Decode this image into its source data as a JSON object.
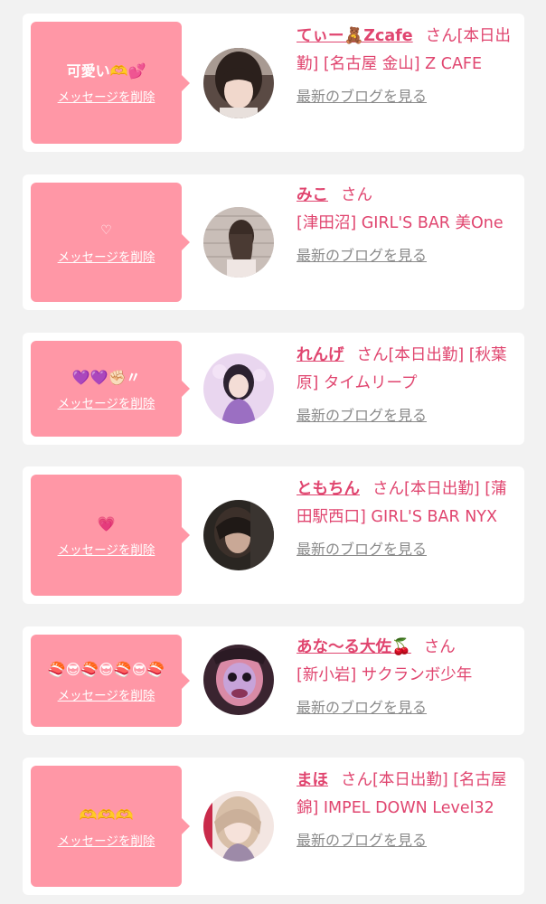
{
  "colors": {
    "background": "#f2f2f2",
    "card": "#ffffff",
    "bubble": "#ff97a6",
    "accent_text": "#e0456f",
    "link_gray": "#8a8a8a"
  },
  "items": [
    {
      "message": "可愛い🫶💕",
      "delete_label": "メッセージを削除",
      "name": "てぃー🧸Zcafe",
      "honorific": "さん",
      "details": "[本日出勤] [名古屋 金山] Z CAFE",
      "blog_label": "最新のブログを見る",
      "avatar_icon": "cast-photo-woman-dark-hair"
    },
    {
      "message": "♡",
      "delete_label": "メッセージを削除",
      "name": "みこ",
      "honorific": "さん",
      "details": "[津田沼] GIRL'S BAR 美One",
      "blog_label": "最新のブログを見る",
      "avatar_icon": "cast-photo-woman-back-view"
    },
    {
      "message": "💜💜✊🏻〃",
      "delete_label": "メッセージを削除",
      "name": "れんげ",
      "honorific": "さん",
      "details": "[本日出勤] [秋葉原] タイムリープ",
      "blog_label": "最新のブログを見る",
      "avatar_icon": "cast-photo-woman-purple-outfit"
    },
    {
      "message": "💗",
      "delete_label": "メッセージを削除",
      "name": "ともちん",
      "honorific": "さん",
      "details": "[本日出勤] [蒲田駅西口] GIRL'S BAR NYX",
      "blog_label": "最新のブログを見る",
      "avatar_icon": "cast-photo-woman-dim-light"
    },
    {
      "message": "🍣😎🍣😎🍣😎🍣",
      "delete_label": "メッセージを削除",
      "name": "あな〜る大佐🍒",
      "honorific": "さん",
      "details": "[新小岩] サクランボ少年",
      "blog_label": "最新のブログを見る",
      "avatar_icon": "cast-photo-face-filter"
    },
    {
      "message": "🫶🫶🫶",
      "delete_label": "メッセージを削除",
      "name": "まほ",
      "honorific": "さん",
      "details": "[本日出勤] [名古屋 錦] IMPEL DOWN Level32",
      "blog_label": "最新のブログを見る",
      "avatar_icon": "cast-photo-woman-blonde"
    }
  ]
}
